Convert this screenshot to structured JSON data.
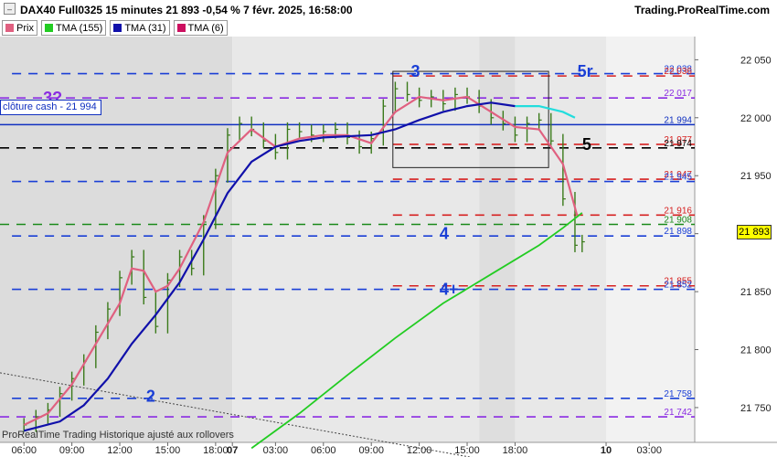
{
  "header": {
    "title": "DAX40 Full0325 15 minutes 21 893 -0,54 % 7 févr. 2025, 16:58:00",
    "site": "Trading.ProRealTime.com"
  },
  "legend": [
    {
      "label": "Prix",
      "color": "#e06080"
    },
    {
      "label": "TMA (155)",
      "color": "#22cc22"
    },
    {
      "label": "TMA (31)",
      "color": "#1010aa"
    },
    {
      "label": "TMA (6)",
      "color": "#cc1060"
    }
  ],
  "cash_label": "clôture cash -  21 994",
  "footer": "ProRealTime Trading  Historique ajusté aux rollovers",
  "last_price": "21 893",
  "annotations": [
    {
      "text": "3",
      "color": "#1a3fd6",
      "x": 10.65,
      "y": 22040
    },
    {
      "text": "5r",
      "color": "#1a3fd6",
      "x": 17.6,
      "y": 22040
    },
    {
      "text": "3?",
      "color": "#8a2be2",
      "x": -4.7,
      "y": 22017
    },
    {
      "text": "5",
      "color": "#000000",
      "x": 17.8,
      "y": 21977
    },
    {
      "text": "4",
      "color": "#1a3fd6",
      "x": 11.85,
      "y": 21900
    },
    {
      "text": "4+",
      "color": "#1a3fd6",
      "x": 11.85,
      "y": 21852
    },
    {
      "text": "2",
      "color": "#1a3fd6",
      "x": -0.4,
      "y": 21760
    }
  ],
  "chart_data": {
    "type": "line",
    "title": "DAX40 Full0325 15 minutes",
    "x_ticks": [
      "06:00",
      "09:00",
      "12:00",
      "15:00",
      "18:00",
      "07",
      "03:00",
      "06:00",
      "09:00",
      "12:00",
      "15:00",
      "18:00",
      "10",
      "03:00"
    ],
    "y_ticks": [
      21750,
      21800,
      21850,
      21900,
      21950,
      22000,
      22050
    ],
    "ylim": [
      21720,
      22070
    ],
    "horizontal_levels": [
      {
        "label": "22 038",
        "value": 22038,
        "color": "#1a3fd6",
        "style": "dashed"
      },
      {
        "label": "22 036",
        "value": 22036,
        "color": "#d62020",
        "style": "dashed"
      },
      {
        "label": "22 017",
        "value": 22017,
        "color": "#8a2be2",
        "style": "dashed"
      },
      {
        "label": "21 994",
        "value": 21994,
        "color": "#1030c0",
        "style": "solid"
      },
      {
        "label": "21 977",
        "value": 21977,
        "color": "#d62020",
        "style": "dashed"
      },
      {
        "label": "21 974",
        "value": 21974,
        "color": "#000000",
        "style": "dashed"
      },
      {
        "label": "21 947",
        "value": 21947,
        "color": "#d62020",
        "style": "dashed"
      },
      {
        "label": "21 945",
        "value": 21945,
        "color": "#1a3fd6",
        "style": "dashed"
      },
      {
        "label": "21 916",
        "value": 21916,
        "color": "#d62020",
        "style": "dashed"
      },
      {
        "label": "21 908",
        "value": 21908,
        "color": "#1a8a1a",
        "style": "dashed"
      },
      {
        "label": "21 898",
        "value": 21898,
        "color": "#1a3fd6",
        "style": "dashed"
      },
      {
        "label": "21 855",
        "value": 21855,
        "color": "#d62020",
        "style": "dashed"
      },
      {
        "label": "21 852",
        "value": 21852,
        "color": "#1a3fd6",
        "style": "dashed"
      },
      {
        "label": "21 758",
        "value": 21758,
        "color": "#1a3fd6",
        "style": "dashed"
      },
      {
        "label": "21 742",
        "value": 21742,
        "color": "#8a2be2",
        "style": "dashed"
      }
    ],
    "series": [
      {
        "name": "Prix",
        "color": "#3a7a1a",
        "x": [
          -5.5,
          -5.0,
          -4.5,
          -4.0,
          -3.5,
          -3.0,
          -2.5,
          -2.0,
          -1.5,
          -1.0,
          -0.5,
          0.0,
          0.5,
          1.0,
          1.5,
          2.0,
          2.5,
          3.0,
          3.5,
          4.0,
          4.5,
          5.0,
          5.5,
          6.0,
          6.5,
          7.0,
          7.5,
          8.0,
          8.5,
          9.0,
          9.5,
          10.0,
          10.5,
          11.0,
          11.5,
          12.0,
          12.5,
          13.0,
          13.5,
          14.0,
          14.5,
          15.0,
          15.5,
          16.0,
          16.5,
          17.0,
          17.5,
          17.8
        ],
        "values": [
          21735,
          21742,
          21748,
          21762,
          21775,
          21790,
          21815,
          21835,
          21862,
          21880,
          21845,
          21820,
          21860,
          21880,
          21870,
          21910,
          21950,
          21985,
          21995,
          21990,
          21980,
          21970,
          21990,
          21988,
          21985,
          21988,
          21990,
          21983,
          21975,
          21982,
          22010,
          22025,
          22020,
          22015,
          22018,
          22012,
          22020,
          22018,
          22010,
          22000,
          21995,
          21985,
          21995,
          21998,
          21980,
          21930,
          21890,
          21893
        ]
      },
      {
        "name": "TMA (6)",
        "color": "#e06080",
        "x": [
          -5.5,
          -4.5,
          -3.5,
          -2.5,
          -1.5,
          -1.0,
          -0.5,
          0.0,
          0.5,
          1.0,
          2.0,
          3.0,
          4.0,
          5.0,
          6.0,
          7.0,
          8.0,
          9.0,
          10.0,
          11.0,
          12.0,
          13.0,
          14.0,
          15.0,
          16.0,
          17.0,
          17.6
        ],
        "values": [
          21735,
          21745,
          21770,
          21805,
          21840,
          21870,
          21868,
          21850,
          21855,
          21870,
          21910,
          21970,
          21990,
          21975,
          21982,
          21985,
          21985,
          21978,
          22005,
          22018,
          22015,
          22018,
          22005,
          21992,
          21990,
          21960,
          21915
        ]
      },
      {
        "name": "TMA (31)",
        "color": "#1010aa",
        "x": [
          -5.5,
          -4.0,
          -3.0,
          -2.0,
          -1.0,
          0.0,
          1.0,
          2.0,
          3.0,
          4.0,
          5.0,
          6.0,
          7.0,
          8.0,
          9.0,
          10.0,
          11.0,
          12.0,
          13.0,
          14.0,
          15.0
        ],
        "values": [
          21730,
          21738,
          21752,
          21775,
          21805,
          21830,
          21858,
          21895,
          21935,
          21962,
          21975,
          21980,
          21983,
          21984,
          21985,
          21990,
          21998,
          22005,
          22010,
          22013,
          22010
        ]
      },
      {
        "name": "TMA (31) projection",
        "color": "#22dddd",
        "x": [
          15.0,
          16.0,
          17.0,
          17.5
        ],
        "values": [
          22010,
          22010,
          22005,
          22000
        ]
      },
      {
        "name": "TMA (155)",
        "color": "#22cc22",
        "x": [
          4.0,
          6.0,
          8.0,
          10.0,
          12.0,
          14.0,
          16.0,
          17.0,
          17.8
        ],
        "values": [
          21715,
          21745,
          21778,
          21810,
          21840,
          21865,
          21890,
          21905,
          21918
        ]
      }
    ]
  }
}
